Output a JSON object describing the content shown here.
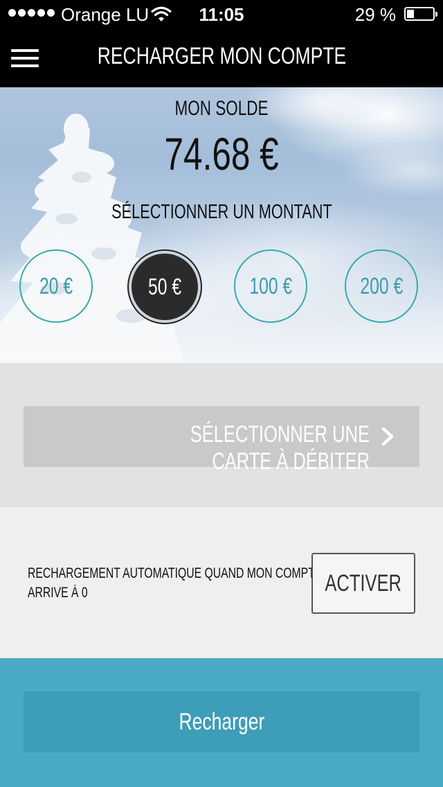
{
  "status_bar": {
    "carrier": "Orange LU",
    "time": "11:05",
    "battery_percent": "29 %",
    "battery_level": 0.29
  },
  "nav": {
    "title": "RECHARGER MON COMPTE",
    "menu_icon": "hamburger-menu-icon"
  },
  "balance": {
    "label": "MON SOLDE",
    "value": "74.68 €"
  },
  "amounts": {
    "label": "SÉLECTIONNER UN MONTANT",
    "options": [
      "20 €",
      "50 €",
      "100 €",
      "200 €"
    ],
    "selected": "50 €"
  },
  "card": {
    "label": "SÉLECTIONNER UNE CARTE À DÉBITER",
    "icon": "chevron-right-icon"
  },
  "auto_recharge": {
    "line1": "RECHARGEMENT AUTOMATIQUE QUAND MON COMPTE",
    "line2": "ARRIVE À 0",
    "button": "ACTIVER"
  },
  "recharge_button": "Recharger",
  "colors": {
    "teal_accent": "#3aa8b0",
    "bottom_bar": "#4aa9c4",
    "recharge_button": "#3e9db8",
    "selected_amount": "#2b2b2b"
  }
}
